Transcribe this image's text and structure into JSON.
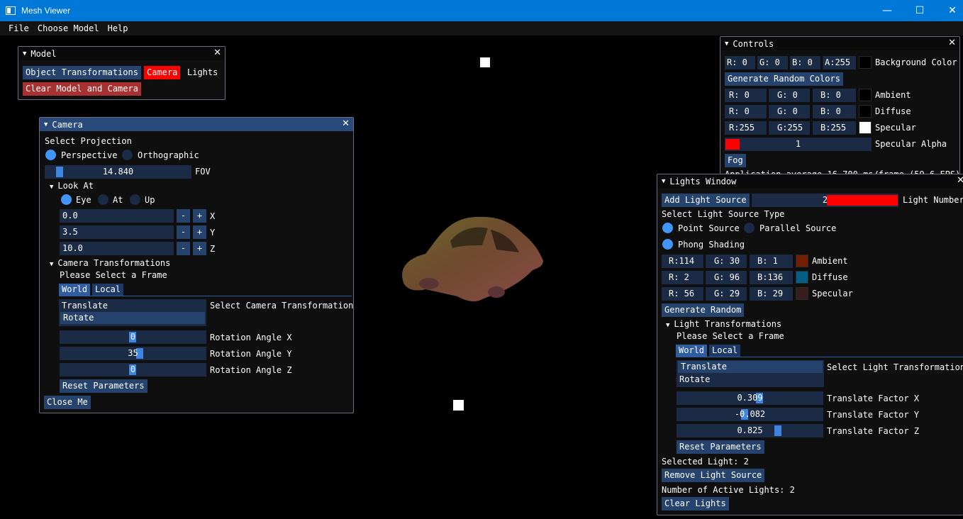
{
  "window": {
    "title": "Mesh Viewer",
    "minimize": "—",
    "maximize": "☐",
    "close": "✕"
  },
  "menu": [
    "File",
    "Choose Model",
    "Help"
  ],
  "colors": {
    "accent": "#4296fa",
    "titlebar": "#0078d7",
    "button": "#26436d",
    "red": "#ff0000"
  },
  "model_window": {
    "title": "Model",
    "tabs": [
      "Object Transformations",
      "Camera",
      "Lights"
    ],
    "clear_button": "Clear Model and Camera"
  },
  "camera_window": {
    "title": "Camera",
    "select_projection": "Select Projection",
    "perspective": "Perspective",
    "orthographic": "Orthographic",
    "fov_value": "14.840",
    "fov_label": "FOV",
    "fov_fraction": 0.08,
    "look_at": "Look At",
    "eye": "Eye",
    "at": "At",
    "up": "Up",
    "coords": [
      {
        "value": "0.0",
        "label": "X"
      },
      {
        "value": "3.5",
        "label": "Y"
      },
      {
        "value": "10.0",
        "label": "Z"
      }
    ],
    "minus": "-",
    "plus": "+",
    "cam_transforms": "Camera Transformations",
    "please_select": "Please Select a Frame",
    "tab_world": "World",
    "tab_local": "Local",
    "list": [
      "Translate",
      "Rotate"
    ],
    "select_transform": "Select Camera Transformation",
    "rot": [
      {
        "value": "0",
        "label": "Rotation Angle X"
      },
      {
        "value": "35",
        "label": "Rotation Angle Y"
      },
      {
        "value": "0",
        "label": "Rotation Angle Z"
      }
    ],
    "reset": "Reset Parameters",
    "close_me": "Close Me"
  },
  "controls_window": {
    "title": "Controls",
    "bg": {
      "r": "R:  0",
      "g": "G:  0",
      "b": "B:  0",
      "a": "A:255",
      "label": "Background Color",
      "color": "#000000"
    },
    "gen_random": "Generate Random Colors",
    "ambient": {
      "r": "R:  0",
      "g": "G:  0",
      "b": "B:  0",
      "label": "Ambient",
      "color": "#000000"
    },
    "diffuse": {
      "r": "R:  0",
      "g": "G:  0",
      "b": "B:  0",
      "label": "Diffuse",
      "color": "#000000"
    },
    "specular": {
      "r": "R:255",
      "g": "G:255",
      "b": "B:255",
      "label": "Specular",
      "color": "#ffffff"
    },
    "alpha_value": "1",
    "alpha_label": "Specular Alpha",
    "fog": "Fog",
    "fps": "Application average 16.700 ms/frame (59.6 FPS)"
  },
  "lights_window": {
    "title": "Lights Window",
    "add": "Add Light Source",
    "light_number_value": "2",
    "light_number_label": "Light Number",
    "select_type": "Select Light Source Type",
    "point": "Point Source",
    "parallel": "Parallel Source",
    "phong": "Phong Shading",
    "ambient": {
      "r": "R:114",
      "g": "G: 30",
      "b": "B:  1",
      "label": "Ambient",
      "color": "#721e01"
    },
    "diffuse": {
      "r": "R:  2",
      "g": "G: 96",
      "b": "B:136",
      "label": "Diffuse",
      "color": "#026088"
    },
    "specular": {
      "r": "R: 56",
      "g": "G: 29",
      "b": "B: 29",
      "label": "Specular",
      "color": "#381d1d"
    },
    "gen_random": "Generate Random",
    "light_transforms": "Light Transformations",
    "please_select": "Please Select a Frame",
    "tab_world": "World",
    "tab_local": "Local",
    "list": [
      "Translate",
      "Rotate"
    ],
    "select_transform": "Select Light Transformation",
    "factors": [
      {
        "value": "0.309",
        "label": "Translate Factor X",
        "fraction": 0.57
      },
      {
        "value": "-0.082",
        "label": "Translate Factor Y",
        "fraction": 0.46
      },
      {
        "value": "0.825",
        "label": "Translate Factor Z",
        "fraction": 0.7
      }
    ],
    "reset": "Reset Parameters",
    "selected": "Selected Light: 2",
    "remove": "Remove Light Source",
    "active": "Number of Active Lights: 2",
    "clear": "Clear Lights"
  }
}
